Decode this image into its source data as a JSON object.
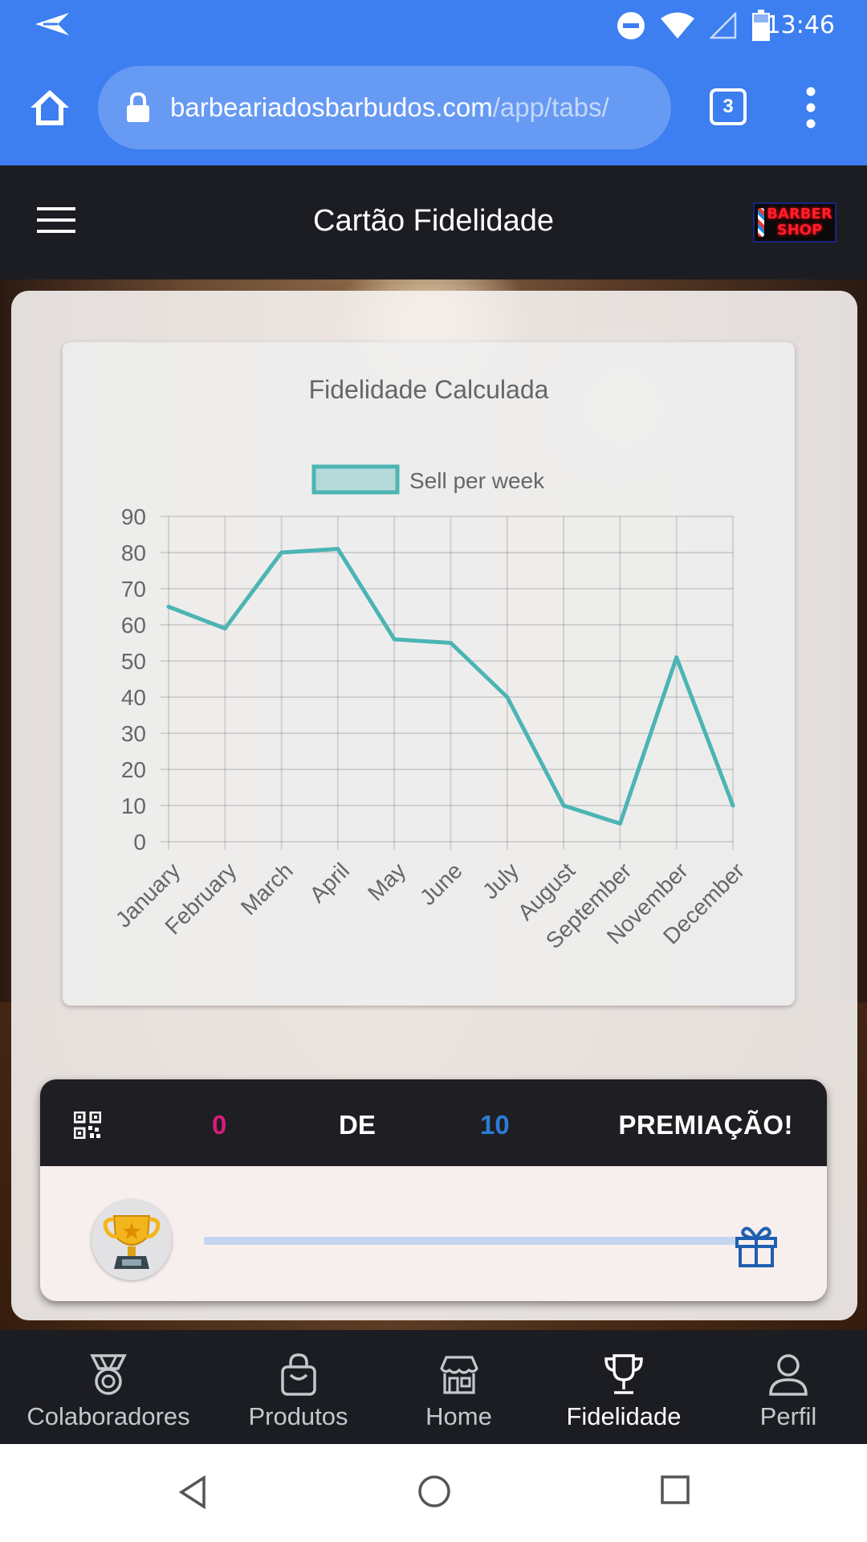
{
  "status_bar": {
    "time": "13:46",
    "icons": [
      "send-icon",
      "do-not-disturb-icon",
      "wifi-icon",
      "signal-icon",
      "battery-icon"
    ]
  },
  "browser": {
    "url_domain": "barbeariadosbarbudos.com",
    "url_path": "/app/tabs/",
    "tab_count": "3",
    "icons": [
      "home-icon",
      "lock-icon",
      "more-vert-icon"
    ]
  },
  "toolbar": {
    "title": "Cartão Fidelidade",
    "logo_text_line1": "BARBER",
    "logo_text_line2": "SHOP"
  },
  "chart_data": {
    "type": "line",
    "title": "Fidelidade Calculada",
    "categories": [
      "January",
      "February",
      "March",
      "April",
      "May",
      "June",
      "July",
      "August",
      "September",
      "November",
      "December"
    ],
    "series": [
      {
        "name": "Sell per week",
        "values": [
          65,
          59,
          80,
          81,
          56,
          55,
          40,
          10,
          5,
          51,
          10
        ],
        "color": "#4bb5b4"
      }
    ],
    "yticks": [
      0,
      10,
      20,
      30,
      40,
      50,
      60,
      70,
      80,
      90
    ],
    "ylim": [
      0,
      90
    ],
    "grid": true,
    "legend_position": "top"
  },
  "fidelity": {
    "current": "0",
    "separator": "DE",
    "total": "10",
    "reward_label": "PREMIAÇÃO!",
    "progress": 0.0,
    "icons": [
      "qr-code-icon",
      "trophy-icon",
      "gift-icon"
    ]
  },
  "tabs": [
    {
      "label": "Colaboradores",
      "icon": "medal-icon",
      "active": false
    },
    {
      "label": "Produtos",
      "icon": "shopping-bag-icon",
      "active": false
    },
    {
      "label": "Home",
      "icon": "storefront-icon",
      "active": false
    },
    {
      "label": "Fidelidade",
      "icon": "trophy-icon",
      "active": true
    },
    {
      "label": "Perfil",
      "icon": "person-icon",
      "active": false
    }
  ],
  "colors": {
    "browser_blue": "#3d7ef0",
    "toolbar_dark": "#1c1d22",
    "accent_pink": "#d81b7c",
    "accent_blue": "#2a7cd6",
    "chart_line": "#4bb5b4"
  }
}
